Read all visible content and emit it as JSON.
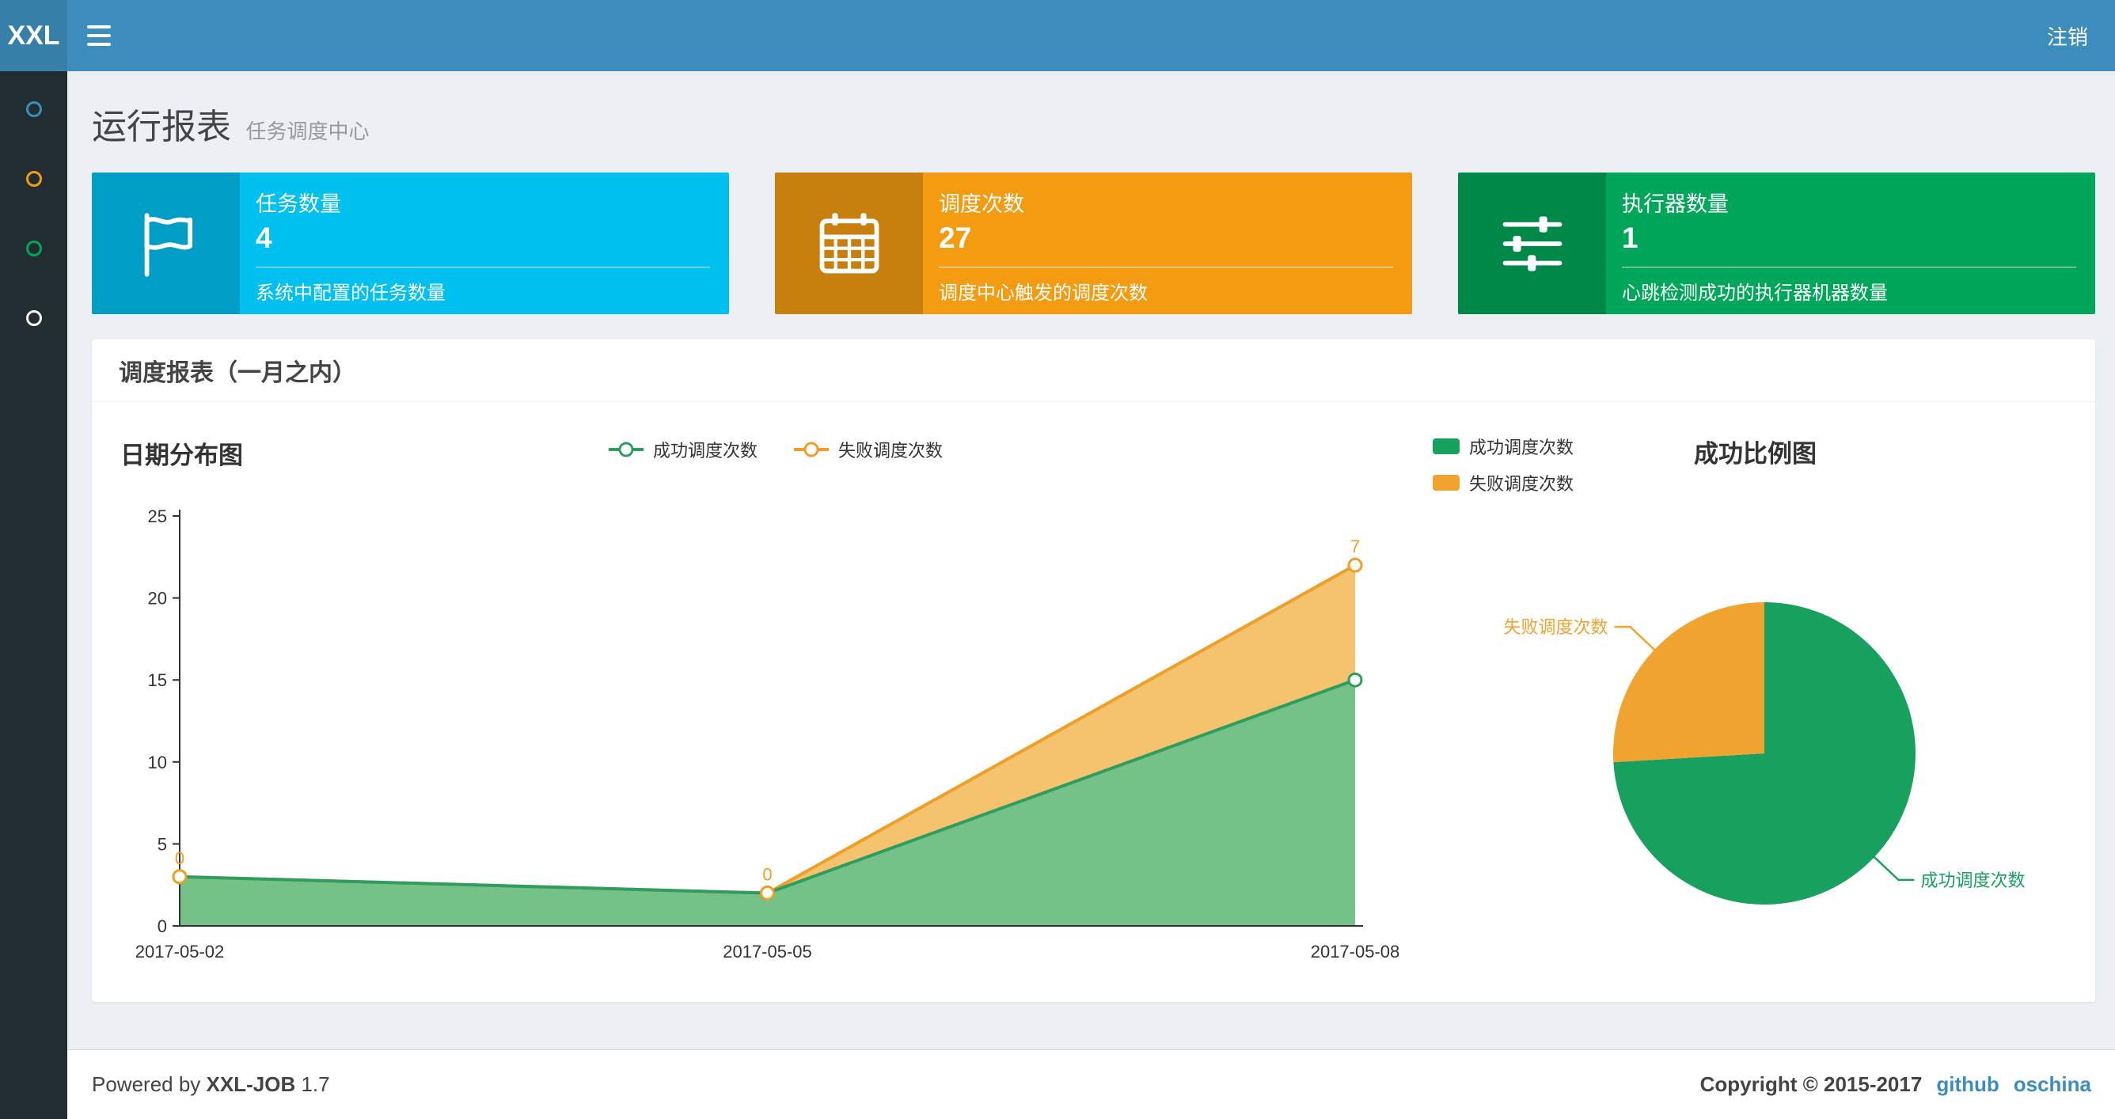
{
  "navbar": {
    "logo_text": "XXL",
    "logout_label": "注销"
  },
  "sidebar": {
    "items": [
      {
        "name": "menu-dashboard",
        "color": "#3c8dbc"
      },
      {
        "name": "menu-jobinfo",
        "color": "#f39c12"
      },
      {
        "name": "menu-joblog",
        "color": "#00a65a"
      },
      {
        "name": "menu-help",
        "color": "#f4f4f4"
      }
    ]
  },
  "page_header": {
    "title": "运行报表",
    "subtitle": "任务调度中心"
  },
  "info_boxes": [
    {
      "title": "任务数量",
      "value": "4",
      "desc": "系统中配置的任务数量",
      "bg": "#00c0ef",
      "icon": "flag-icon"
    },
    {
      "title": "调度次数",
      "value": "27",
      "desc": "调度中心触发的调度次数",
      "bg": "#f39c12",
      "icon": "calendar-icon"
    },
    {
      "title": "执行器数量",
      "value": "1",
      "desc": "心跳检测成功的执行器机器数量",
      "bg": "#00a65a",
      "icon": "sliders-icon"
    }
  ],
  "panel": {
    "title": "调度报表（一月之内）"
  },
  "chart_data": [
    {
      "type": "area",
      "title": "日期分布图",
      "x": [
        "2017-05-02",
        "2017-05-05",
        "2017-05-08"
      ],
      "series": [
        {
          "name": "成功调度次数",
          "values": [
            3,
            2,
            15
          ],
          "color": "#2f9d5f",
          "fill": "#74c287"
        },
        {
          "name": "失败调度次数",
          "values": [
            0,
            0,
            7
          ],
          "color": "#ef9f28",
          "fill": "#f5c36e",
          "stacked": true,
          "point_labels": [
            "0",
            "0",
            "7"
          ]
        }
      ],
      "ylim": [
        0,
        25
      ],
      "yticks": [
        0,
        5,
        10,
        15,
        20,
        25
      ],
      "legend_position": "top-center",
      "grid": false
    },
    {
      "type": "pie",
      "title": "成功比例图",
      "slices": [
        {
          "name": "成功调度次数",
          "value": 20,
          "color": "#17a05e"
        },
        {
          "name": "失败调度次数",
          "value": 7,
          "color": "#f0a32f"
        }
      ],
      "legend_position": "top-left"
    }
  ],
  "footer": {
    "powered_prefix": "Powered by",
    "product": "XXL-JOB",
    "version": "1.7",
    "copyright": "Copyright © 2015-2017",
    "links": [
      {
        "label": "github"
      },
      {
        "label": "oschina"
      }
    ]
  }
}
